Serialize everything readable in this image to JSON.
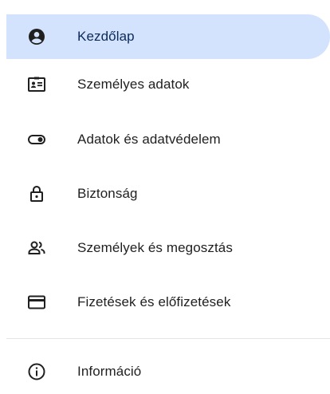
{
  "nav": {
    "items": [
      {
        "label": "Kezdőlap",
        "icon": "account-circle-icon",
        "active": true
      },
      {
        "label": "Személyes adatok",
        "icon": "id-card-icon",
        "active": false
      },
      {
        "label": "Adatok és adatvédelem",
        "icon": "toggle-icon",
        "active": false
      },
      {
        "label": "Biztonság",
        "icon": "lock-icon",
        "active": false
      },
      {
        "label": "Személyek és megosztás",
        "icon": "people-icon",
        "active": false
      },
      {
        "label": "Fizetések és előfizetések",
        "icon": "credit-card-icon",
        "active": false
      }
    ],
    "footer_items": [
      {
        "label": "Információ",
        "icon": "info-icon",
        "active": false
      }
    ]
  },
  "colors": {
    "active_background": "#d3e3fd",
    "icon": "#1f1f1f",
    "divider": "#e3e3e3"
  }
}
